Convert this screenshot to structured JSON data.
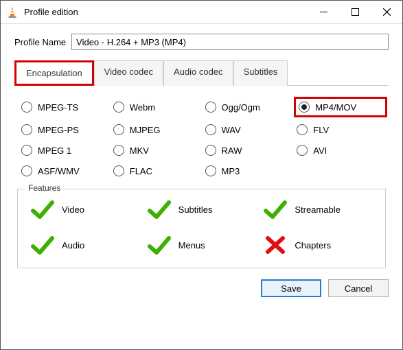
{
  "window": {
    "title": "Profile edition"
  },
  "profile": {
    "name_label": "Profile Name",
    "name_value": "Video - H.264 + MP3 (MP4)"
  },
  "tabs": {
    "encapsulation": "Encapsulation",
    "video_codec": "Video codec",
    "audio_codec": "Audio codec",
    "subtitles": "Subtitles",
    "active": "encapsulation"
  },
  "encapsulation_options": {
    "mpeg_ts": "MPEG-TS",
    "webm": "Webm",
    "ogg": "Ogg/Ogm",
    "mp4": "MP4/MOV",
    "mpeg_ps": "MPEG-PS",
    "mjpeg": "MJPEG",
    "wav": "WAV",
    "flv": "FLV",
    "mpeg1": "MPEG 1",
    "mkv": "MKV",
    "raw": "RAW",
    "avi": "AVI",
    "asf": "ASF/WMV",
    "flac": "FLAC",
    "mp3": "MP3",
    "selected": "mp4"
  },
  "features": {
    "legend": "Features",
    "video": {
      "label": "Video",
      "ok": true
    },
    "subtitles": {
      "label": "Subtitles",
      "ok": true
    },
    "streamable": {
      "label": "Streamable",
      "ok": true
    },
    "audio": {
      "label": "Audio",
      "ok": true
    },
    "menus": {
      "label": "Menus",
      "ok": true
    },
    "chapters": {
      "label": "Chapters",
      "ok": false
    }
  },
  "buttons": {
    "save": "Save",
    "cancel": "Cancel"
  },
  "highlights": {
    "tab_encapsulation": true,
    "radio_mp4": true
  },
  "colors": {
    "highlight": "#d60000",
    "check": "#3eb000",
    "cross": "#dd1111",
    "primary_border": "#2a7ad4"
  }
}
